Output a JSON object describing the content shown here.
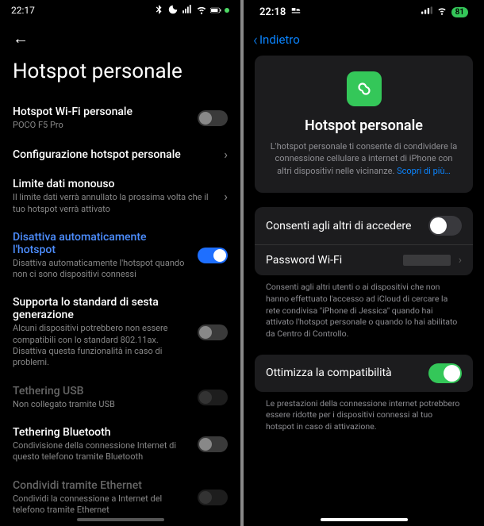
{
  "android": {
    "status": {
      "time": "22:17",
      "battery": "80"
    },
    "page_title": "Hotspot personale",
    "rows": {
      "wifi_hotspot": {
        "title": "Hotspot Wi-Fi personale",
        "sub": "POCO F5 Pro",
        "on": false
      },
      "config": {
        "title": "Configurazione hotspot personale"
      },
      "data_limit": {
        "title": "Limite dati monouso",
        "sub": "Il limite dati verrà annullato la prossima volta che il tuo hotspot verrà attivato"
      },
      "auto_off": {
        "title": "Disattiva automaticamente l'hotspot",
        "sub": "Disattiva automaticamente l'hotspot quando non ci sono dispositivi connessi",
        "on": true
      },
      "sixth_gen": {
        "title": "Supporta lo standard di sesta generazione",
        "sub": "Alcuni dispositivi potrebbero non essere compatibili con lo standard 802.11ax. Disattiva questa funzionalità in caso di problemi.",
        "on": false
      },
      "usb": {
        "title": "Tethering USB",
        "sub": "Non collegato tramite USB",
        "on": false,
        "disabled": true
      },
      "bt": {
        "title": "Tethering Bluetooth",
        "sub": "Condivisione della connessione Internet di questo telefono tramite Bluetooth",
        "on": false
      },
      "eth": {
        "title": "Condividi tramite Ethernet",
        "sub": "Condividi la connessione a Internet del telefono tramite Ethernet",
        "on": false,
        "disabled": true
      }
    }
  },
  "ios": {
    "status": {
      "time": "22:18",
      "battery": "81"
    },
    "back_label": "Indietro",
    "hero": {
      "title": "Hotspot personale",
      "desc": "L'hotspot personale ti consente di condividere la connessione cellulare a internet di iPhone con altri dispositivi nelle vicinanze.",
      "link": "Scopri di più…"
    },
    "allow_others": {
      "label": "Consenti agli altri di accedere",
      "on": false
    },
    "wifi_password": {
      "label": "Password Wi-Fi"
    },
    "allow_others_footer": "Consenti agli altri utenti o ai dispositivi che non hanno effettuato l'accesso ad iCloud di cercare la rete condivisa \"iPhone di Jessica\" quando hai attivato l'hotspot personale o quando lo hai abilitato da Centro di Controllo.",
    "optimize": {
      "label": "Ottimizza la compatibilità",
      "on": true
    },
    "optimize_footer": "Le prestazioni della connessione internet potrebbero essere ridotte per i dispositivi connessi al tuo hotspot in caso di attivazione."
  }
}
